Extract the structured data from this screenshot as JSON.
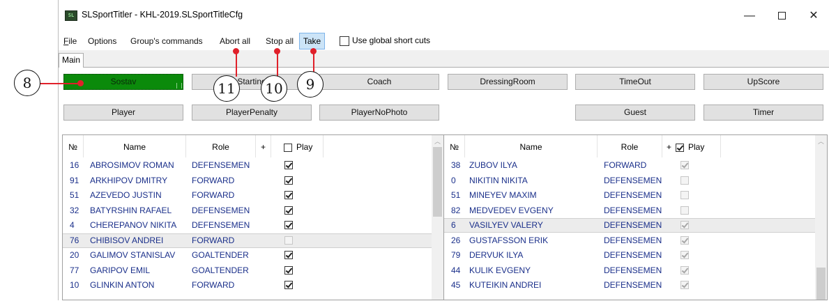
{
  "window": {
    "title": "SLSportTitler - KHL-2019.SLSportTitleCfg",
    "icon": "app-icon",
    "minimize": "—",
    "close": "✕"
  },
  "menu": {
    "file": "File",
    "options": "Options",
    "group": "Group's commands",
    "abort_all": "Abort all",
    "stop_all": "Stop all",
    "take": "Take",
    "global_shortcuts": "Use global short cuts",
    "global_shortcuts_checked": false
  },
  "tabs": {
    "main": "Main"
  },
  "buttons": {
    "sostav": "Sostav",
    "starting": "Starting",
    "coach": "Coach",
    "dressing": "DressingRoom",
    "timeout": "TimeOut",
    "upscore": "UpScore",
    "player": "Player",
    "penalty": "PlayerPenalty",
    "nophoto": "PlayerNoPhoto",
    "guest": "Guest",
    "timer": "Timer"
  },
  "callouts": {
    "c8": "8",
    "c11": "11",
    "c10": "10",
    "c9": "9"
  },
  "colors": {
    "active_button": "#0b8a0b",
    "callout_red": "#e0202a",
    "text_blue": "#1a2f8a"
  },
  "left_grid": {
    "headers": {
      "num": "№",
      "name": "Name",
      "role": "Role",
      "plus": "+",
      "play": "Play"
    },
    "play_all_checked": false,
    "rows": [
      {
        "num": "16",
        "name": "ABROSIMOV ROMAN",
        "role": "DEFENSEMEN",
        "play": true,
        "enabled": true
      },
      {
        "num": "91",
        "name": "ARKHIPOV DMITRY",
        "role": "FORWARD",
        "play": true,
        "enabled": true
      },
      {
        "num": "51",
        "name": "AZEVEDO JUSTIN",
        "role": "FORWARD",
        "play": true,
        "enabled": true
      },
      {
        "num": "32",
        "name": "BATYRSHIN RAFAEL",
        "role": "DEFENSEMEN",
        "play": true,
        "enabled": true
      },
      {
        "num": "4",
        "name": "CHEREPANOV NIKITA",
        "role": "DEFENSEMEN",
        "play": true,
        "enabled": true
      },
      {
        "num": "76",
        "name": "CHIBISOV ANDREI",
        "role": "FORWARD",
        "play": false,
        "enabled": false,
        "selected": true
      },
      {
        "num": "20",
        "name": "GALIMOV STANISLAV",
        "role": "GOALTENDER",
        "play": true,
        "enabled": true
      },
      {
        "num": "77",
        "name": "GARIPOV EMIL",
        "role": "GOALTENDER",
        "play": true,
        "enabled": true
      },
      {
        "num": "10",
        "name": "GLINKIN ANTON",
        "role": "FORWARD",
        "play": true,
        "enabled": true
      }
    ]
  },
  "right_grid": {
    "headers": {
      "num": "№",
      "name": "Name",
      "role": "Role",
      "plus": "+",
      "play": "Play"
    },
    "play_all_checked": true,
    "rows": [
      {
        "num": "38",
        "name": "ZUBOV ILYA",
        "role": "FORWARD",
        "play": true,
        "enabled": false
      },
      {
        "num": "0",
        "name": "NIKITIN NIKITA",
        "role": "DEFENSEMEN",
        "play": false,
        "enabled": false
      },
      {
        "num": "51",
        "name": "MINEYEV MAXIM",
        "role": "DEFENSEMEN",
        "play": false,
        "enabled": false
      },
      {
        "num": "82",
        "name": "MEDVEDEV EVGENY",
        "role": "DEFENSEMEN",
        "play": false,
        "enabled": false
      },
      {
        "num": "6",
        "name": "VASILYEV VALERY",
        "role": "DEFENSEMEN",
        "play": true,
        "enabled": false,
        "selected": true
      },
      {
        "num": "26",
        "name": "GUSTAFSSON ERIK",
        "role": "DEFENSEMEN",
        "play": true,
        "enabled": false
      },
      {
        "num": "79",
        "name": "DERVUK ILYA",
        "role": "DEFENSEMEN",
        "play": true,
        "enabled": false
      },
      {
        "num": "44",
        "name": "KULIK EVGENY",
        "role": "DEFENSEMEN",
        "play": true,
        "enabled": false
      },
      {
        "num": "45",
        "name": "KUTEIKIN ANDREI",
        "role": "DEFENSEMEN",
        "play": true,
        "enabled": false
      }
    ]
  }
}
